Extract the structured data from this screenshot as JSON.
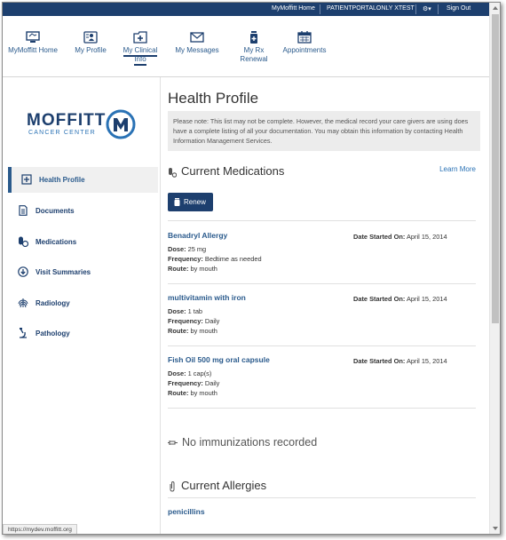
{
  "topbar": {
    "home": "MyMoffitt Home",
    "user": "PATIENTPORTALONLY XTEST",
    "gear": "⚙▾",
    "signout": "Sign Out"
  },
  "nav": {
    "items": [
      {
        "label": "MyMoffitt Home",
        "icon": "monitor-icon"
      },
      {
        "label": "My Profile",
        "icon": "profile-card-icon"
      },
      {
        "label": "My Clinical Info",
        "icon": "medical-folder-icon"
      },
      {
        "label": "My Messages",
        "icon": "envelope-icon"
      },
      {
        "label": "My Rx Renewal",
        "icon": "pill-bottle-icon"
      },
      {
        "label": "Appointments",
        "icon": "calendar-icon"
      }
    ]
  },
  "sidebar": {
    "logo": {
      "word": "MOFFITT",
      "sub": "CANCER CENTER"
    },
    "items": [
      {
        "label": "Health Profile",
        "icon": "health-profile-icon"
      },
      {
        "label": "Documents",
        "icon": "document-icon"
      },
      {
        "label": "Medications",
        "icon": "pills-icon"
      },
      {
        "label": "Visit Summaries",
        "icon": "download-circle-icon"
      },
      {
        "label": "Radiology",
        "icon": "xray-icon"
      },
      {
        "label": "Pathology",
        "icon": "microscope-icon"
      }
    ]
  },
  "main": {
    "title": "Health Profile",
    "notice": "Please note: This list may not be complete. However, the medical record your care givers are using does have a complete listing of all your documentation. You may obtain this information by contacting Health Information Management Services.",
    "medications_title": "Current Medications",
    "learn_more": "Learn More",
    "renew": "Renew",
    "labels": {
      "dose": "Dose:",
      "frequency": "Frequency:",
      "route": "Route:",
      "date_started": "Date Started On:"
    },
    "medications": [
      {
        "name": "Benadryl Allergy",
        "dose": "25 mg",
        "frequency": "Bedtime as needed",
        "route": "by mouth",
        "date": "April 15, 2014"
      },
      {
        "name": "multivitamin with iron",
        "dose": "1 tab",
        "frequency": "Daily",
        "route": "by mouth",
        "date": "April 15, 2014"
      },
      {
        "name": "Fish Oil 500 mg oral capsule",
        "dose": "1 cap(s)",
        "frequency": "Daily",
        "route": "by mouth",
        "date": "April 15, 2014"
      }
    ],
    "immunizations_empty": "No immunizations recorded",
    "allergies_title": "Current Allergies",
    "allergies": [
      {
        "name": "penicillins"
      }
    ]
  },
  "status": {
    "url": "https://mydev.moffitt.org"
  }
}
